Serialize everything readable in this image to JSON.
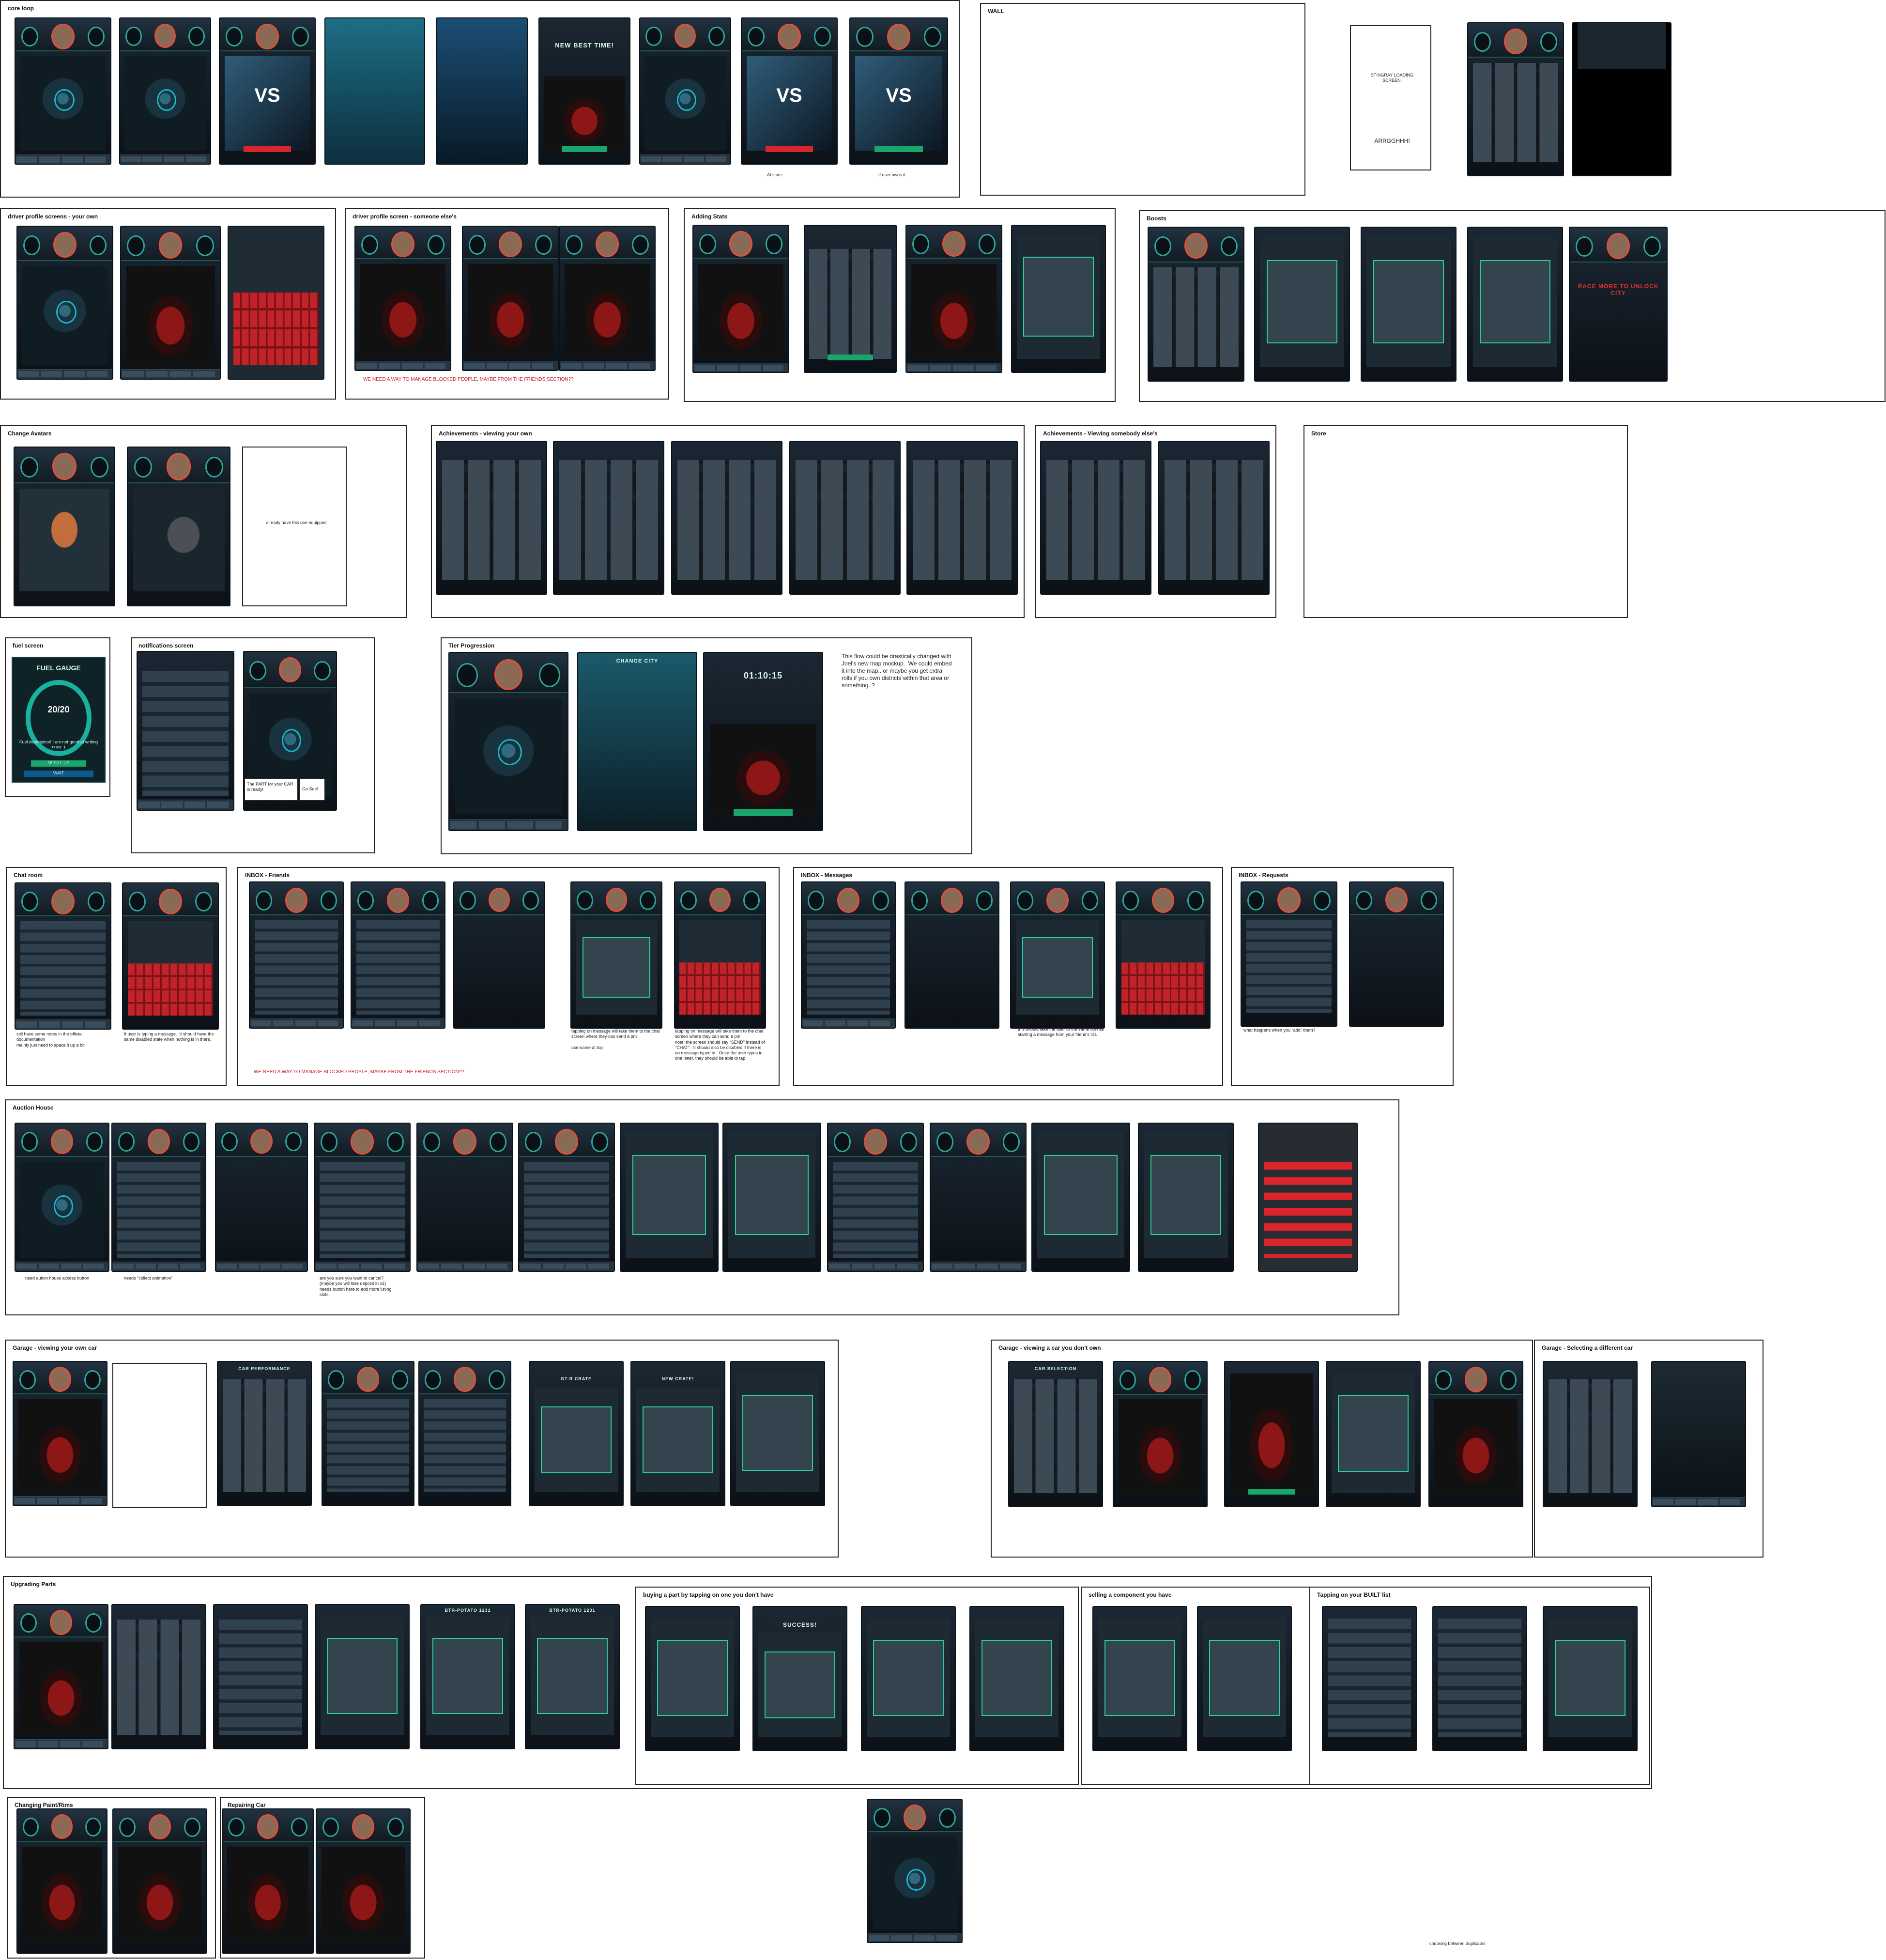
{
  "colors": {
    "teal_accent": "#2aa69b",
    "red_button": "#d8262b",
    "green_button": "#19a56b",
    "screen_bg": "#121b22"
  },
  "sections": {
    "core_loop": "core loop",
    "wall": "WALL",
    "driver_profile_own": "driver profile screens - your own",
    "driver_profile_else": "driver profile screen - someone else's",
    "adding_stats": "Adding Stats",
    "boosts": "Boosts",
    "change_avatars": "Change Avatars",
    "achievements_own": "Achievements - viewing your own",
    "achievements_else": "Achievements - Viewing somebody else's",
    "store": "Store",
    "fuel_screen": "fuel screen",
    "notifications": "notifications screen",
    "tier_progression": "Tier Progression",
    "chat_room": "Chat room",
    "inbox_friends": "INBOX - Friends",
    "inbox_messages": "INBOX - Messages",
    "inbox_requests": "INBOX - Requests",
    "auction_house": "Auction House",
    "garage_own": "Garage - viewing your own car",
    "garage_dont_own": "Garage - viewing a car you don't own",
    "garage_select": "Garage - Selecting a different car",
    "upgrading_parts": "Upgrading Parts",
    "buying_part": "buying a part by tapping on one you don't have",
    "selling_component": "selling a component you have",
    "tapping_built": "Tapping on your BUILT list",
    "changing_paint": "Changing Paint/Rims",
    "repairing_car": "Repairing Car"
  },
  "notes": {
    "ai_state": "AI state",
    "if_user_owns": "If user owns it",
    "stingray": "STINGRAY LOADING SCREEN.",
    "arrgh": "ARRGGHHH!",
    "blocked_1": "WE NEED A WAY TO MANAGE BLOCKED PEOPLE, MAYBE FROM THE FRIENDS SECTION??",
    "blocked_2": "WE NEED A WAY TO MANAGE BLOCKED PEOPLE, MAYBE FROM THE FRIENDS SECTION??",
    "already_equipped": "already have this one equipped",
    "tier_flow": "This flow could be drastically changed with Joel's new map mockup.  We could embed it into the map.. or maybe you get extra rolls if you own districts within that area or something..?",
    "part_ready": "The PART for your CAR is ready!",
    "go_see": "Go See!",
    "chat_notes": "still have some notes in the official documentation\nmainly just need to space it up a bit",
    "chat_typing": "If user is typing a message.  It should have the same disabled state when nothing is in there.",
    "inbox_tap_message": "tapping on message will take them to the chat screen where they can send a pm\n\nusername at top",
    "inbox_tap_message_2": "tapping on message will take them to the chat screen where they can send a pm\nnote: the screen should say \"SEND\" instead of \"CHAT\".  It should also be disabled if there is no message typed in.  Once the user types in one letter, they should be able to tap",
    "inbox_same_flow": "this should take the user to the same flow as starting a message from your friend's list.",
    "inbox_requests_q": "what happens when you \"add\" them?",
    "auction_access": "need aution house access button",
    "auction_collect": "needs \"collect animation\"",
    "auction_cancel": "are you sure you want to cancel? (maybe you will lose deposit in v2)\nneeds button here to add more listing slots",
    "store_label": "Store",
    "choosing_between": "choosing between duplicates"
  },
  "screen_text": {
    "fuel_title": "FUEL GAUGE",
    "fuel_value": "20/20",
    "fuel_desc": "Fuel description! I am not good at writing copy :)",
    "fuel_fill": "16 FILL UP",
    "fuel_wait": "WAIT",
    "new_best": "NEW BEST TIME!",
    "best_time": "01:10:15",
    "race": "RACE!",
    "collect": "COLLECT",
    "gtr_crate": "GT-R CRATE",
    "new_crate": "NEW CRATE!",
    "car_performance": "CAR PERFORMANCE",
    "car_selection": "CAR SELECTION",
    "race_more": "RACE MORE TO UNLOCK CITY",
    "change_city": "CHANGE CITY",
    "btr_potato": "BTR-POTATO 1231",
    "success": "SUCCESS!"
  }
}
